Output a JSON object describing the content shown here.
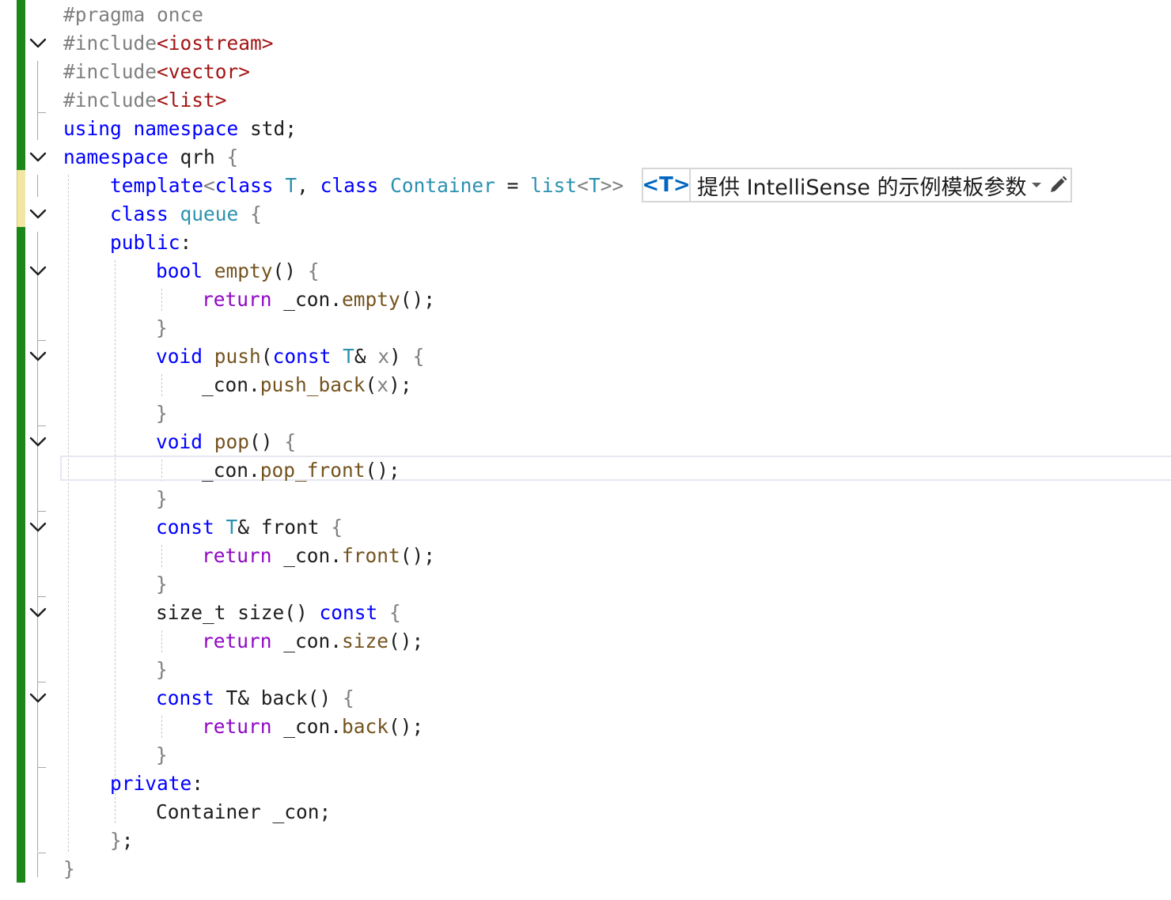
{
  "editor": {
    "lines": [
      [
        {
          "t": "#pragma once",
          "c": "pp"
        }
      ],
      [
        {
          "t": "#include",
          "c": "pp"
        },
        {
          "t": "<iostream>",
          "c": "str"
        }
      ],
      [
        {
          "t": "#include",
          "c": "pp"
        },
        {
          "t": "<vector>",
          "c": "str"
        }
      ],
      [
        {
          "t": "#include",
          "c": "pp"
        },
        {
          "t": "<list>",
          "c": "str"
        }
      ],
      [
        {
          "t": "using",
          "c": "kw"
        },
        {
          "t": " "
        },
        {
          "t": "namespace",
          "c": "kw"
        },
        {
          "t": " std;"
        }
      ],
      [
        {
          "t": "namespace",
          "c": "kw"
        },
        {
          "t": " qrh "
        },
        {
          "t": "{",
          "c": "dim"
        }
      ],
      [
        {
          "t": "template",
          "c": "kw"
        },
        {
          "t": "<",
          "c": "dim"
        },
        {
          "t": "class",
          "c": "kw"
        },
        {
          "t": " "
        },
        {
          "t": "T",
          "c": "ty"
        },
        {
          "t": ", "
        },
        {
          "t": "class",
          "c": "kw"
        },
        {
          "t": " "
        },
        {
          "t": "Container",
          "c": "ty"
        },
        {
          "t": " = "
        },
        {
          "t": "list",
          "c": "ty"
        },
        {
          "t": "<",
          "c": "dim"
        },
        {
          "t": "T",
          "c": "ty"
        },
        {
          "t": ">>",
          "c": "dim"
        }
      ],
      [
        {
          "t": "class",
          "c": "kw"
        },
        {
          "t": " "
        },
        {
          "t": "queue",
          "c": "ty"
        },
        {
          "t": " "
        },
        {
          "t": "{",
          "c": "dim"
        }
      ],
      [
        {
          "t": "public",
          "c": "kw"
        },
        {
          "t": ":"
        }
      ],
      [
        {
          "t": "bool",
          "c": "kw"
        },
        {
          "t": " "
        },
        {
          "t": "empty",
          "c": "fn"
        },
        {
          "t": "() "
        },
        {
          "t": "{",
          "c": "dim"
        }
      ],
      [
        {
          "t": "return",
          "c": "ctl"
        },
        {
          "t": " _con."
        },
        {
          "t": "empty",
          "c": "fn"
        },
        {
          "t": "();"
        }
      ],
      [
        {
          "t": "}",
          "c": "dim"
        }
      ],
      [
        {
          "t": "void",
          "c": "kw"
        },
        {
          "t": " "
        },
        {
          "t": "push",
          "c": "fn"
        },
        {
          "t": "("
        },
        {
          "t": "const",
          "c": "kw"
        },
        {
          "t": " "
        },
        {
          "t": "T",
          "c": "ty"
        },
        {
          "t": "& "
        },
        {
          "t": "x",
          "c": "prm"
        },
        {
          "t": ") "
        },
        {
          "t": "{",
          "c": "dim"
        }
      ],
      [
        {
          "t": "_con."
        },
        {
          "t": "push_back",
          "c": "fn"
        },
        {
          "t": "("
        },
        {
          "t": "x",
          "c": "prm"
        },
        {
          "t": ");"
        }
      ],
      [
        {
          "t": "}",
          "c": "dim"
        }
      ],
      [
        {
          "t": "void",
          "c": "kw"
        },
        {
          "t": " "
        },
        {
          "t": "pop",
          "c": "fn"
        },
        {
          "t": "() "
        },
        {
          "t": "{",
          "c": "dim"
        }
      ],
      [
        {
          "t": "_con."
        },
        {
          "t": "pop_front",
          "c": "fn"
        },
        {
          "t": "();"
        }
      ],
      [
        {
          "t": "}",
          "c": "dim"
        }
      ],
      [
        {
          "t": "const",
          "c": "kw"
        },
        {
          "t": " "
        },
        {
          "t": "T",
          "c": "ty"
        },
        {
          "t": "& front "
        },
        {
          "t": "{",
          "c": "dim"
        }
      ],
      [
        {
          "t": "return",
          "c": "ctl"
        },
        {
          "t": " _con."
        },
        {
          "t": "front",
          "c": "fn"
        },
        {
          "t": "();"
        }
      ],
      [
        {
          "t": "}",
          "c": "dim"
        }
      ],
      [
        {
          "t": "size_t size() "
        },
        {
          "t": "const",
          "c": "kw"
        },
        {
          "t": " "
        },
        {
          "t": "{",
          "c": "dim"
        }
      ],
      [
        {
          "t": "return",
          "c": "ctl"
        },
        {
          "t": " _con."
        },
        {
          "t": "size",
          "c": "fn"
        },
        {
          "t": "();"
        }
      ],
      [
        {
          "t": "}",
          "c": "dim"
        }
      ],
      [
        {
          "t": "const",
          "c": "kw"
        },
        {
          "t": " T& back() "
        },
        {
          "t": "{",
          "c": "dim"
        }
      ],
      [
        {
          "t": "return",
          "c": "ctl"
        },
        {
          "t": " _con."
        },
        {
          "t": "back",
          "c": "fn"
        },
        {
          "t": "();"
        }
      ],
      [
        {
          "t": "}",
          "c": "dim"
        }
      ],
      [
        {
          "t": "private",
          "c": "kw"
        },
        {
          "t": ":"
        }
      ],
      [
        {
          "t": "Container _con;"
        }
      ],
      [
        {
          "t": "}",
          "c": "dim"
        },
        {
          "t": ";"
        }
      ],
      [
        {
          "t": "}",
          "c": "dim"
        }
      ]
    ]
  },
  "hint": {
    "tag": "<T>",
    "text": "提供 IntelliSense 的示例模板参数"
  },
  "colors": {
    "keyword": "#0000ff",
    "type": "#2b91af",
    "function": "#74531f",
    "preprocessor": "#808080",
    "string": "#a31515",
    "control": "#8f08c4",
    "change_saved": "#1b8719",
    "change_unsaved": "#f1e6a4"
  },
  "icons": {
    "fold": "chevron-down-icon",
    "hint_dropdown": "caret-down-icon",
    "hint_edit": "pencil-icon"
  }
}
